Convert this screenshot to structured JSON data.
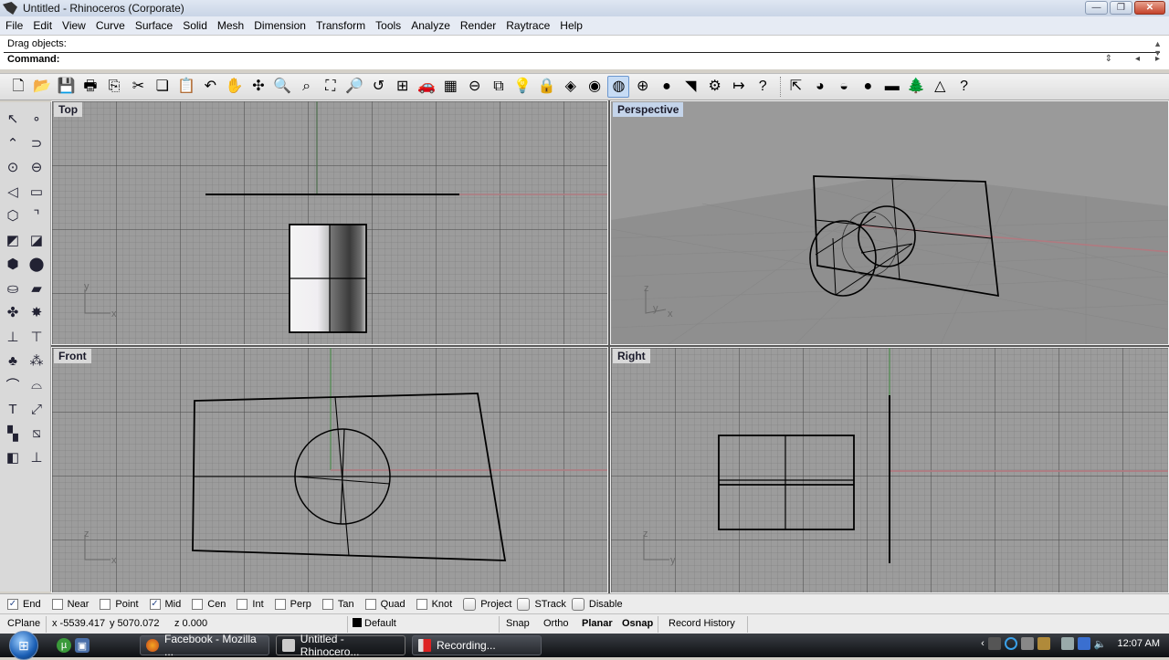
{
  "window": {
    "title": "Untitled - Rhinoceros (Corporate)",
    "buttons": {
      "minimize": "—",
      "restore": "❐",
      "close": "✕"
    }
  },
  "menu": [
    "File",
    "Edit",
    "View",
    "Curve",
    "Surface",
    "Solid",
    "Mesh",
    "Dimension",
    "Transform",
    "Tools",
    "Analyze",
    "Render",
    "Raytrace",
    "Help"
  ],
  "command": {
    "history_line": "Drag objects:",
    "prompt": "Command:",
    "prompt_value": ""
  },
  "toolbar": {
    "buttons": [
      {
        "name": "new-icon",
        "glyph": "🗋"
      },
      {
        "name": "open-icon",
        "glyph": "📂"
      },
      {
        "name": "save-icon",
        "glyph": "💾"
      },
      {
        "name": "print-icon",
        "glyph": "🖶"
      },
      {
        "name": "export-icon",
        "glyph": "⎘"
      },
      {
        "name": "cut-icon",
        "glyph": "✂"
      },
      {
        "name": "copy-icon",
        "glyph": "❏"
      },
      {
        "name": "paste-icon",
        "glyph": "📋"
      },
      {
        "name": "undo-icon",
        "glyph": "↶"
      },
      {
        "name": "pan-icon",
        "glyph": "✋"
      },
      {
        "name": "rotate-view-icon",
        "glyph": "✣"
      },
      {
        "name": "zoom-dynamic-icon",
        "glyph": "🔍"
      },
      {
        "name": "zoom-window-icon",
        "glyph": "⌕"
      },
      {
        "name": "zoom-extents-icon",
        "glyph": "⛶"
      },
      {
        "name": "zoom-selected-icon",
        "glyph": "🔎"
      },
      {
        "name": "undo-view-icon",
        "glyph": "↺"
      },
      {
        "name": "four-viewports-icon",
        "glyph": "⊞"
      },
      {
        "name": "car-icon",
        "glyph": "🚗"
      },
      {
        "name": "cplane-grid-icon",
        "glyph": "▦"
      },
      {
        "name": "cplane-origin-icon",
        "glyph": "⊖"
      },
      {
        "name": "select-shapes-icon",
        "glyph": "⧉"
      },
      {
        "name": "lightbulb-icon",
        "glyph": "💡"
      },
      {
        "name": "lock-icon",
        "glyph": "🔒"
      },
      {
        "name": "layer-icon",
        "glyph": "◈"
      },
      {
        "name": "color-wheel-icon",
        "glyph": "◉"
      },
      {
        "name": "wireframe-icon",
        "glyph": "◍",
        "active": true
      },
      {
        "name": "shaded-grid-icon",
        "glyph": "⊕"
      },
      {
        "name": "rendered-sphere-icon",
        "glyph": "●"
      },
      {
        "name": "triangle-flag-icon",
        "glyph": "◥"
      },
      {
        "name": "options-gear-icon",
        "glyph": "⚙"
      },
      {
        "name": "dimension-icon",
        "glyph": "↦"
      },
      {
        "name": "help-icon",
        "glyph": "?"
      },
      {
        "name": "render-export-icon",
        "glyph": "⇱"
      },
      {
        "name": "render-save-icon",
        "glyph": "◕"
      },
      {
        "name": "render-preview-icon",
        "glyph": "◒"
      },
      {
        "name": "render-icon",
        "glyph": "●"
      },
      {
        "name": "environment-icon",
        "glyph": "▬"
      },
      {
        "name": "tree-icon",
        "glyph": "🌲"
      },
      {
        "name": "spotlight-icon",
        "glyph": "△"
      },
      {
        "name": "render-help-icon",
        "glyph": "?"
      }
    ]
  },
  "left_tools": [
    {
      "name": "select-arrow-icon",
      "glyph": "↖"
    },
    {
      "name": "point-icon",
      "glyph": "∘"
    },
    {
      "name": "polyline-icon",
      "glyph": "⌃"
    },
    {
      "name": "curve-icon",
      "glyph": "⊃"
    },
    {
      "name": "circle-icon",
      "glyph": "⊙"
    },
    {
      "name": "ellipse-icon",
      "glyph": "⊖"
    },
    {
      "name": "arc-icon",
      "glyph": "◁"
    },
    {
      "name": "rectangle-icon",
      "glyph": "▭"
    },
    {
      "name": "polygon-icon",
      "glyph": "⬡"
    },
    {
      "name": "fillet-curve-icon",
      "glyph": "⌝"
    },
    {
      "name": "surface-corner-icon",
      "glyph": "◩"
    },
    {
      "name": "surface-edge-icon",
      "glyph": "◪"
    },
    {
      "name": "box-icon",
      "glyph": "⬢"
    },
    {
      "name": "sphere-icon",
      "glyph": "⬤"
    },
    {
      "name": "cylinder-icon",
      "glyph": "⛀"
    },
    {
      "name": "mesh-plane-icon",
      "glyph": "▰"
    },
    {
      "name": "boolean-icon",
      "glyph": "✤"
    },
    {
      "name": "explode-icon",
      "glyph": "✸"
    },
    {
      "name": "trim-icon",
      "glyph": "⊥"
    },
    {
      "name": "split-icon",
      "glyph": "⊤"
    },
    {
      "name": "boolean-union-icon",
      "glyph": "♣"
    },
    {
      "name": "boolean-difference-icon",
      "glyph": "⁂"
    },
    {
      "name": "edit-points-icon",
      "glyph": "⌒"
    },
    {
      "name": "control-points-icon",
      "glyph": "⌓"
    },
    {
      "name": "text-icon",
      "glyph": "T"
    },
    {
      "name": "move-icon",
      "glyph": "⤢"
    },
    {
      "name": "group-icon",
      "glyph": "▚"
    },
    {
      "name": "transform-icon",
      "glyph": "⧅"
    },
    {
      "name": "solid-edit-icon",
      "glyph": "◧"
    },
    {
      "name": "dimension-tools-icon",
      "glyph": "⊥"
    }
  ],
  "viewports": {
    "top": {
      "label": "Top",
      "axis_a": "y",
      "axis_b": "x"
    },
    "perspective": {
      "label": "Perspective",
      "axis_a": "z",
      "axis_b": "y",
      "axis_c": "x"
    },
    "front": {
      "label": "Front",
      "axis_a": "z",
      "axis_b": "x"
    },
    "right": {
      "label": "Right",
      "axis_a": "z",
      "axis_b": "y"
    }
  },
  "osnaps": [
    {
      "label": "End",
      "checked": true
    },
    {
      "label": "Near",
      "checked": false
    },
    {
      "label": "Point",
      "checked": false
    },
    {
      "label": "Mid",
      "checked": true
    },
    {
      "label": "Cen",
      "checked": false
    },
    {
      "label": "Int",
      "checked": false
    },
    {
      "label": "Perp",
      "checked": false
    },
    {
      "label": "Tan",
      "checked": false
    },
    {
      "label": "Quad",
      "checked": false
    },
    {
      "label": "Knot",
      "checked": false
    }
  ],
  "osnap_toggles": [
    {
      "label": "Project",
      "checked": false
    },
    {
      "label": "STrack",
      "checked": false
    },
    {
      "label": "Disable",
      "checked": false
    }
  ],
  "status": {
    "cplane": "CPlane",
    "x": "x -5539.417",
    "y": "y 5070.072",
    "z": "z 0.000",
    "layer": "Default",
    "snap": "Snap",
    "ortho": "Ortho",
    "planar": "Planar",
    "osnap": "Osnap",
    "record_history": "Record History"
  },
  "taskbar": {
    "items": [
      {
        "label": "Facebook - Mozilla ...",
        "icon": "firefox-icon"
      },
      {
        "label": "Untitled - Rhinocero...",
        "icon": "rhino-icon",
        "active": true
      },
      {
        "label": "Recording...",
        "icon": "recording-icon"
      }
    ],
    "clock": "12:07 AM"
  },
  "colors": {
    "x_axis": "#b07a80",
    "y_axis": "#4e8a4e",
    "viewport_bg": "#9c9c9c",
    "active_label": "#c4d4ea"
  }
}
